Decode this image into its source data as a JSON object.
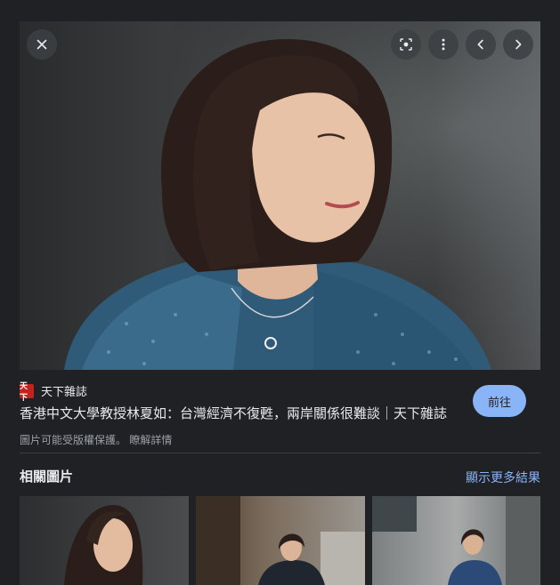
{
  "controls": {
    "close_icon": "close-icon",
    "lens_icon": "lens-icon",
    "more_icon": "more-vert-icon",
    "prev_icon": "chevron-left-icon",
    "next_icon": "chevron-right-icon"
  },
  "source": {
    "favicon_text": "天下",
    "name": "天下雜誌",
    "title": "香港中文大學教授林夏如：台灣經濟不復甦，兩岸關係很難談｜天下雜誌"
  },
  "visit_button": "前往",
  "copyright": {
    "notice": "圖片可能受版權保護。",
    "learn_more": "瞭解詳情"
  },
  "related": {
    "title": "相關圖片",
    "more_results": "顯示更多結果"
  },
  "colors": {
    "accent": "#8ab4f8",
    "background": "#202124",
    "favicon_red": "#c5221f"
  }
}
